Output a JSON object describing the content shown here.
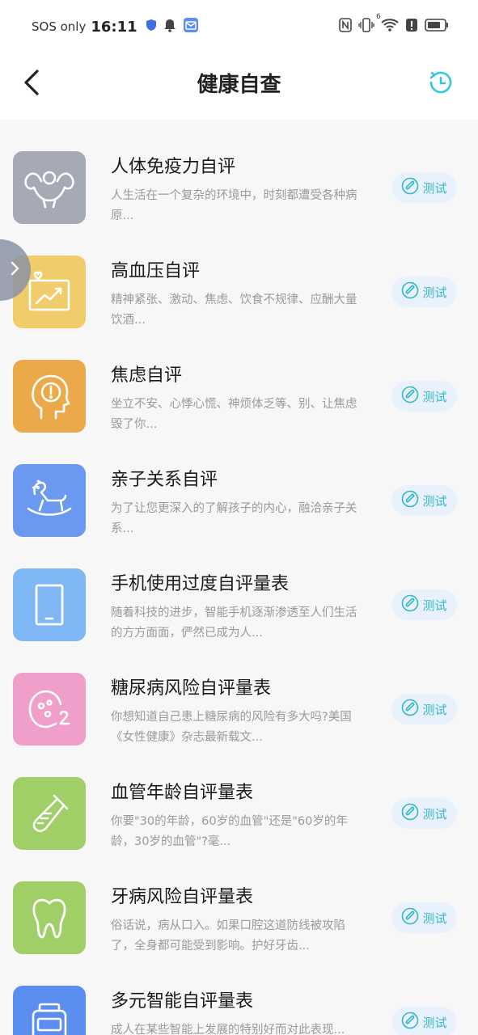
{
  "status_bar": {
    "carrier": "SOS only",
    "time": "16:11",
    "signal_badge": "6"
  },
  "header": {
    "title": "健康自查",
    "back_icon": "back-arrow-icon",
    "history_icon": "history-clock-icon"
  },
  "colors": {
    "accent": "#33b8c8",
    "test_button_bg": "#e9f2fc"
  },
  "items": [
    {
      "title": "人体免疫力自评",
      "desc": "人生活在一个复杂的环境中，时刻都遭受各种病原...",
      "button": "测试",
      "icon": "muscle-icon",
      "color": "#a6a9b6"
    },
    {
      "title": "高血压自评",
      "desc": "精神紧张、激动、焦虑、饮食不规律、应酬大量饮酒...",
      "button": "测试",
      "icon": "chart-heart-icon",
      "color": "#f0cc6a"
    },
    {
      "title": "焦虑自评",
      "desc": "坐立不安、心悸心慌、神烦体乏等、别、让焦虑毁了你...",
      "button": "测试",
      "icon": "head-exclaim-icon",
      "color": "#eca94a"
    },
    {
      "title": "亲子关系自评",
      "desc": "为了让您更深入的了解孩子的内心，融洽亲子关系...",
      "button": "测试",
      "icon": "rocking-horse-icon",
      "color": "#6b98f0"
    },
    {
      "title": "手机使用过度自评量表",
      "desc": "随着科技的进步，智能手机逐渐渗透至人们生活的方方面面，俨然已成为人...",
      "button": "测试",
      "icon": "phone-icon",
      "color": "#7fb7f4"
    },
    {
      "title": "糖尿病风险自评量表",
      "desc": "你想知道自己患上糖尿病的风险有多大吗?美国《女性健康》杂志最新载文...",
      "button": "测试",
      "icon": "glucose-icon",
      "color": "#ef9fc9"
    },
    {
      "title": "血管年龄自评量表",
      "desc": "你要\"30的年龄，60岁的血管\"还是\"60岁的年龄，30岁的血管\"?毫...",
      "button": "测试",
      "icon": "test-tube-icon",
      "color": "#9fcf66"
    },
    {
      "title": "牙病风险自评量表",
      "desc": "俗话说，病从口入。如果口腔这道防线被攻陷了，全身都可能受到影响。护好牙齿...",
      "button": "测试",
      "icon": "tooth-icon",
      "color": "#9fcf66"
    },
    {
      "title": "多元智能自评量表",
      "desc": "成人在某些智能上发展的特别好而对此表现...",
      "button": "测试",
      "icon": "scale-icon",
      "color": "#5b8ef0"
    }
  ]
}
